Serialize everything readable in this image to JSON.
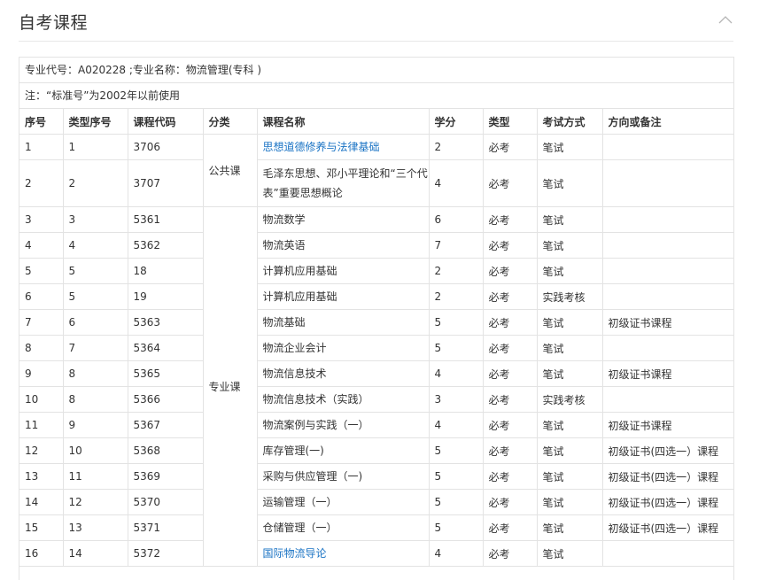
{
  "header": {
    "title": "自考课程"
  },
  "info": {
    "major_line": "专业代号：A020228 ;专业名称：物流管理(专科 )",
    "note_line": "注：“标准号”为2002年以前使用"
  },
  "table": {
    "columns": [
      "序号",
      "类型序号",
      "课程代码",
      "分类",
      "课程名称",
      "学分",
      "类型",
      "考试方式",
      "方向或备注"
    ],
    "groups": {
      "public": "公共课",
      "major": "专业课"
    },
    "rows": [
      {
        "no": "1",
        "type_no": "1",
        "code": "3706",
        "name": "思想道德修养与法律基础",
        "credit": "2",
        "kind": "必考",
        "exam": "笔试",
        "note": "",
        "link": true
      },
      {
        "no": "2",
        "type_no": "2",
        "code": "3707",
        "name": "毛泽东思想、邓小平理论和“三个代表”重要思想概论",
        "credit": "4",
        "kind": "必考",
        "exam": "笔试",
        "note": "",
        "link": false
      },
      {
        "no": "3",
        "type_no": "3",
        "code": "5361",
        "name": "物流数学",
        "credit": "6",
        "kind": "必考",
        "exam": "笔试",
        "note": "",
        "link": false
      },
      {
        "no": "4",
        "type_no": "4",
        "code": "5362",
        "name": "物流英语",
        "credit": "7",
        "kind": "必考",
        "exam": "笔试",
        "note": "",
        "link": false
      },
      {
        "no": "5",
        "type_no": "5",
        "code": "18",
        "name": "计算机应用基础",
        "credit": "2",
        "kind": "必考",
        "exam": "笔试",
        "note": "",
        "link": false
      },
      {
        "no": "6",
        "type_no": "5",
        "code": "19",
        "name": "计算机应用基础",
        "credit": "2",
        "kind": "必考",
        "exam": "实践考核",
        "note": "",
        "link": false
      },
      {
        "no": "7",
        "type_no": "6",
        "code": "5363",
        "name": "物流基础",
        "credit": "5",
        "kind": "必考",
        "exam": "笔试",
        "note": "初级证书课程",
        "link": false
      },
      {
        "no": "8",
        "type_no": "7",
        "code": "5364",
        "name": "物流企业会计",
        "credit": "5",
        "kind": "必考",
        "exam": "笔试",
        "note": "",
        "link": false
      },
      {
        "no": "9",
        "type_no": "8",
        "code": "5365",
        "name": "物流信息技术",
        "credit": "4",
        "kind": "必考",
        "exam": "笔试",
        "note": "初级证书课程",
        "link": false
      },
      {
        "no": "10",
        "type_no": "8",
        "code": "5366",
        "name": "物流信息技术（实践）",
        "credit": "3",
        "kind": "必考",
        "exam": "实践考核",
        "note": "",
        "link": false
      },
      {
        "no": "11",
        "type_no": "9",
        "code": "5367",
        "name": "物流案例与实践（一）",
        "credit": "4",
        "kind": "必考",
        "exam": "笔试",
        "note": "初级证书课程",
        "link": false
      },
      {
        "no": "12",
        "type_no": "10",
        "code": "5368",
        "name": "库存管理(一)",
        "credit": "5",
        "kind": "必考",
        "exam": "笔试",
        "note": "初级证书(四选一）课程",
        "link": false
      },
      {
        "no": "13",
        "type_no": "11",
        "code": "5369",
        "name": "采购与供应管理（一)",
        "credit": "5",
        "kind": "必考",
        "exam": "笔试",
        "note": "初级证书(四选一）课程",
        "link": false
      },
      {
        "no": "14",
        "type_no": "12",
        "code": "5370",
        "name": "运输管理（一）",
        "credit": "5",
        "kind": "必考",
        "exam": "笔试",
        "note": "初级证书(四选一）课程",
        "link": false
      },
      {
        "no": "15",
        "type_no": "13",
        "code": "5371",
        "name": "仓储管理（一）",
        "credit": "5",
        "kind": "必考",
        "exam": "笔试",
        "note": "初级证书(四选一）课程",
        "link": false
      },
      {
        "no": "16",
        "type_no": "14",
        "code": "5372",
        "name": "国际物流导论",
        "credit": "4",
        "kind": "必考",
        "exam": "笔试",
        "note": "",
        "link": true
      }
    ]
  },
  "colors": {
    "link": "#1a73c4",
    "border": "#e3e3e3",
    "text": "#333333"
  }
}
